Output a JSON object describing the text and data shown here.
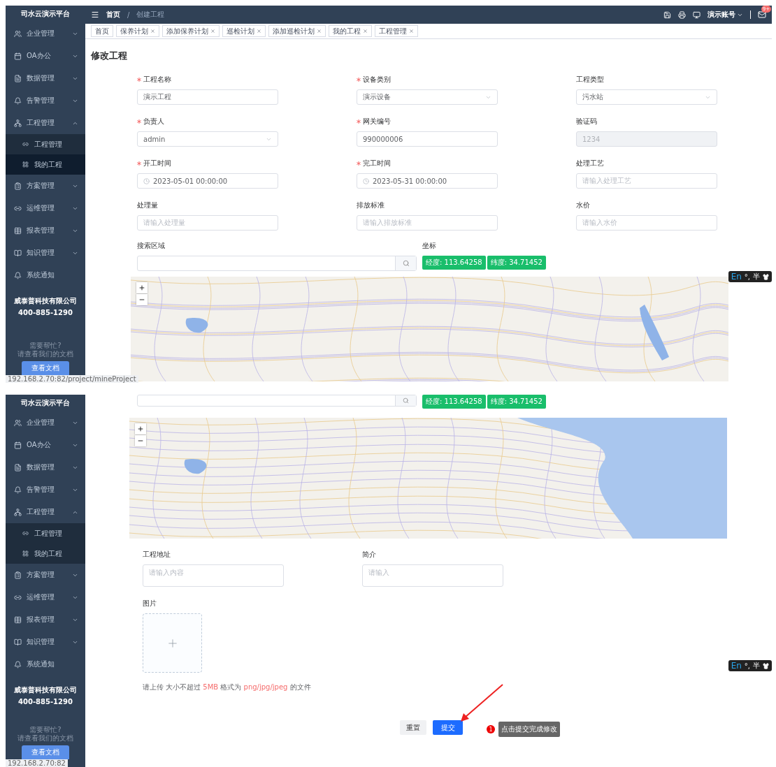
{
  "screens": [
    {
      "kind": "top",
      "sidebar": {
        "title": "司水云演示平台",
        "items": [
          {
            "label": "企业管理",
            "kind": "group",
            "expanded": false
          },
          {
            "label": "OA办公",
            "kind": "group",
            "expanded": false
          },
          {
            "label": "数据管理",
            "kind": "group",
            "expanded": false
          },
          {
            "label": "告警管理",
            "kind": "group",
            "expanded": false
          },
          {
            "label": "工程管理",
            "kind": "group",
            "expanded": true,
            "children": [
              {
                "label": "工程管理",
                "selected": false
              },
              {
                "label": "我的工程",
                "selected": true
              }
            ]
          },
          {
            "label": "方案管理",
            "kind": "group",
            "expanded": false
          },
          {
            "label": "运维管理",
            "kind": "group",
            "expanded": false
          },
          {
            "label": "报表管理",
            "kind": "group",
            "expanded": false
          },
          {
            "label": "知识管理",
            "kind": "group",
            "expanded": false
          },
          {
            "label": "系统通知",
            "kind": "link"
          }
        ],
        "company": "威泰普科技有限公司",
        "phone": "400-885-1290",
        "help": [
          "需要帮忙?",
          "请查看我们的文档"
        ],
        "button": "查看文档",
        "status_url": "192.168.2.70:82/project/mineProject"
      },
      "header": {
        "breadcrumb": [
          "首页",
          "创建工程"
        ],
        "separator": "/",
        "account": "演示账号",
        "badge": "9+"
      },
      "tabs": [
        {
          "label": "首页",
          "closable": false
        },
        {
          "label": "保养计划",
          "closable": true
        },
        {
          "label": "添加保养计划",
          "closable": true
        },
        {
          "label": "巡检计划",
          "closable": true
        },
        {
          "label": "添加巡检计划",
          "closable": true
        },
        {
          "label": "我的工程",
          "closable": true
        },
        {
          "label": "工程管理",
          "closable": true
        }
      ],
      "page_title": "修改工程",
      "fields": [
        {
          "label": "工程名称",
          "required": true,
          "kind": "input",
          "value": "演示工程"
        },
        {
          "label": "设备类别",
          "required": true,
          "kind": "select",
          "value": "演示设备"
        },
        {
          "label": "工程类型",
          "required": false,
          "kind": "select",
          "value": "污水站"
        },
        {
          "label": "负责人",
          "required": true,
          "kind": "select",
          "value": "admin"
        },
        {
          "label": "网关编号",
          "required": true,
          "kind": "input",
          "value": "990000006"
        },
        {
          "label": "验证码",
          "required": false,
          "kind": "input",
          "value": "1234",
          "disabled": true
        },
        {
          "label": "开工时间",
          "required": true,
          "kind": "date",
          "value": "2023-05-01 00:00:00"
        },
        {
          "label": "完工时间",
          "required": true,
          "kind": "date",
          "value": "2023-05-31 00:00:00"
        },
        {
          "label": "处理工艺",
          "required": false,
          "kind": "input",
          "placeholder": "请输入处理工艺"
        },
        {
          "label": "处理量",
          "required": false,
          "kind": "input",
          "placeholder": "请输入处理量"
        },
        {
          "label": "排放标准",
          "required": false,
          "kind": "input",
          "placeholder": "请输入排放标准"
        },
        {
          "label": "水价",
          "required": false,
          "kind": "input",
          "placeholder": "请输入水价"
        }
      ],
      "search": {
        "label": "搜索区域",
        "coord_label": "坐标",
        "coords": [
          "经度: 113.64258",
          "纬度: 34.71452"
        ]
      },
      "map": {
        "kind": "inland"
      },
      "ime": [
        "En",
        "°,",
        "半"
      ]
    },
    {
      "kind": "bottom",
      "sidebar": {
        "title": "司水云演示平台",
        "items": [
          {
            "label": "企业管理",
            "kind": "group",
            "expanded": false
          },
          {
            "label": "OA办公",
            "kind": "group",
            "expanded": false
          },
          {
            "label": "数据管理",
            "kind": "group",
            "expanded": false
          },
          {
            "label": "告警管理",
            "kind": "group",
            "expanded": false
          },
          {
            "label": "工程管理",
            "kind": "group",
            "expanded": true,
            "children": [
              {
                "label": "工程管理",
                "selected": false
              },
              {
                "label": "我的工程",
                "selected": false
              }
            ]
          },
          {
            "label": "方案管理",
            "kind": "group",
            "expanded": false
          },
          {
            "label": "运维管理",
            "kind": "group",
            "expanded": false
          },
          {
            "label": "报表管理",
            "kind": "group",
            "expanded": false
          },
          {
            "label": "知识管理",
            "kind": "group",
            "expanded": false
          },
          {
            "label": "系统通知",
            "kind": "link"
          }
        ],
        "company": "威泰普科技有限公司",
        "phone": "400-885-1290",
        "help": [
          "需要帮忙?",
          "请查看我们的文档"
        ],
        "button": "查看文档",
        "status_url": "192.168.2.70:82"
      },
      "search": {
        "coords": [
          "经度: 113.64258",
          "纬度: 34.71452"
        ]
      },
      "map": {
        "kind": "coastal"
      },
      "text_fields": [
        {
          "label": "工程地址",
          "placeholder": "请输入内容"
        },
        {
          "label": "简介",
          "placeholder": "请输入"
        }
      ],
      "upload": {
        "label": "图片",
        "hint": [
          {
            "text": "请上传 大小不超过 ",
            "highlight": false
          },
          {
            "text": "5MB",
            "highlight": true
          },
          {
            "text": " 格式为 ",
            "highlight": false
          },
          {
            "text": "png/jpg/jpeg",
            "highlight": true
          },
          {
            "text": " 的文件",
            "highlight": false
          }
        ]
      },
      "buttons": [
        {
          "label": "重置",
          "kind": "default"
        },
        {
          "label": "提交",
          "kind": "primary"
        }
      ],
      "tooltip": {
        "step": "1",
        "text": "点击提交完成修改"
      },
      "ime": [
        "En",
        "°,",
        "半"
      ]
    }
  ]
}
